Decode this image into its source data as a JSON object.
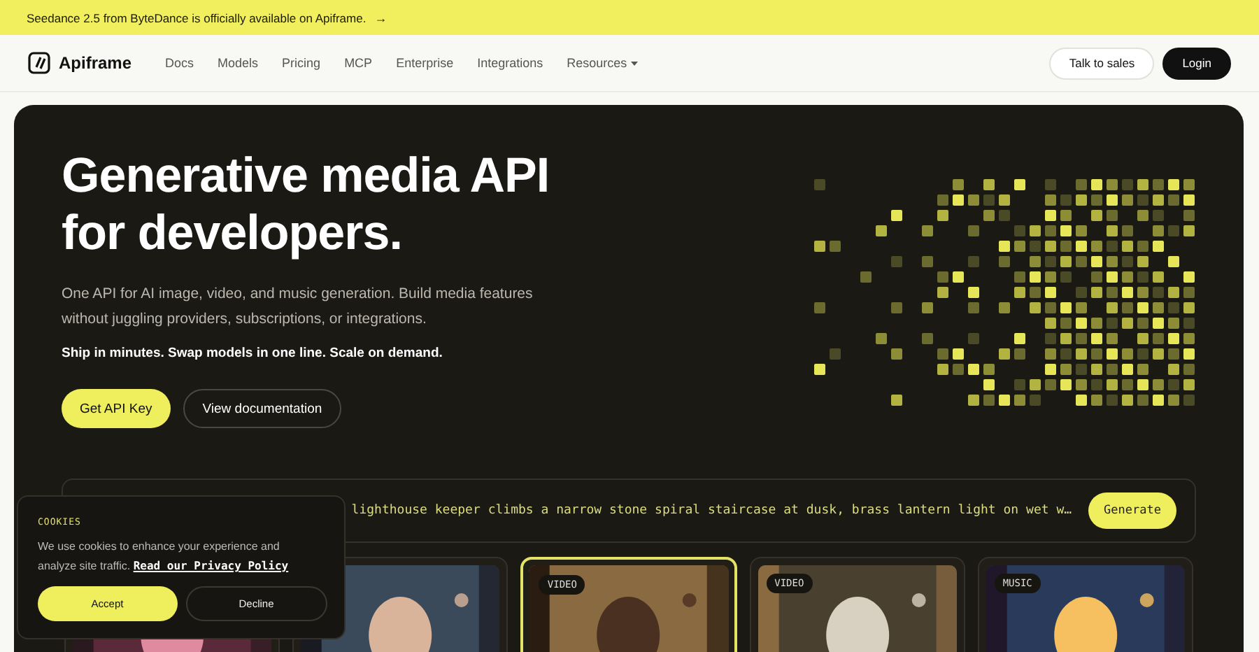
{
  "banner": {
    "text": "Seedance 2.5 from ByteDance is officially available on Apiframe.",
    "arrow": "→"
  },
  "nav": {
    "logo": "Apiframe",
    "links": [
      {
        "label": "Docs",
        "has_menu": false
      },
      {
        "label": "Models",
        "has_menu": false
      },
      {
        "label": "Pricing",
        "has_menu": false
      },
      {
        "label": "MCP",
        "has_menu": false
      },
      {
        "label": "Enterprise",
        "has_menu": false
      },
      {
        "label": "Integrations",
        "has_menu": false
      },
      {
        "label": "Resources",
        "has_menu": true
      }
    ],
    "buttons": [
      {
        "label": "Talk to sales",
        "kind": "outline"
      },
      {
        "label": "Login",
        "kind": "solid"
      }
    ]
  },
  "hero": {
    "title_lines": [
      "Generative media API",
      "for developers."
    ],
    "subtitle": "One API for AI image, video, and music generation. Build media features without juggling providers, subscriptions, or integrations.",
    "tagline": "Ship in minutes. Swap models in one line. Scale on demand.",
    "buttons": [
      {
        "label": "Get API Key",
        "kind": "primary"
      },
      {
        "label": "View documentation",
        "kind": "outline"
      }
    ]
  },
  "prompt": {
    "value": "lighthouse keeper climbs a narrow stone spiral staircase at dusk, brass lantern light on wet w…",
    "button": "Generate"
  },
  "cards": [
    {
      "kind": "picture",
      "selected": false
    },
    {
      "kind": "picture",
      "selected": false
    },
    {
      "kind": "picture",
      "selected": true,
      "badge": "VIDEO"
    },
    {
      "kind": "picture",
      "selected": false,
      "badge": "VIDEO"
    },
    {
      "kind": "picture",
      "selected": false,
      "badge": "MUSIC"
    }
  ],
  "cookie": {
    "heading": "COOKIES",
    "text": "We use cookies to enhance your experience and analyze site traffic.",
    "link": "Read our Privacy Policy",
    "accept": "Accept",
    "decline": "Decline"
  }
}
